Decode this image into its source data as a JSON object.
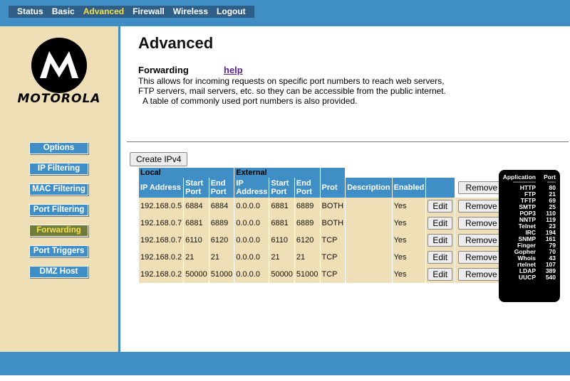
{
  "topnav": {
    "items": [
      "Status",
      "Basic",
      "Advanced",
      "Firewall",
      "Wireless",
      "Logout"
    ],
    "active": "Advanced"
  },
  "brand": {
    "name": "MOTOROLA"
  },
  "sidebar": {
    "items": [
      "Options",
      "IP Filtering",
      "MAC Filtering",
      "Port Filtering",
      "Forwarding",
      "Port Triggers",
      "DMZ Host"
    ],
    "active": "Forwarding"
  },
  "page": {
    "title": "Advanced",
    "section": "Forwarding",
    "help": "help",
    "description_1": "This allows for incoming requests on specific port numbers to reach  web servers,",
    "description_2": "FTP servers, mail servers, etc. so they can be accessible from the public internet.",
    "description_3": "A table of commonly used port numbers is also provided.",
    "create_button": "Create IPv4"
  },
  "table": {
    "group_local": "Local",
    "group_external": "External",
    "headers": [
      "IP Address",
      "Start Port",
      "End Port",
      "IP Address",
      "Start Port",
      "End Port",
      "Prot",
      "Description",
      "Enabled"
    ],
    "remove_all": "Remove All",
    "edit_label": "Edit",
    "remove_label": "Remove",
    "rows": [
      [
        "192.168.0.5",
        "6884",
        "6884",
        "0.0.0.0",
        "6881",
        "6889",
        "BOTH",
        "",
        "Yes"
      ],
      [
        "192.168.0.7",
        "6881",
        "6889",
        "0.0.0.0",
        "6881",
        "6889",
        "BOTH",
        "",
        "Yes"
      ],
      [
        "192.168.0.7",
        "6110",
        "6120",
        "0.0.0.0",
        "6110",
        "6120",
        "TCP",
        "",
        "Yes"
      ],
      [
        "192.168.0.2",
        "21",
        "21",
        "0.0.0.0",
        "21",
        "21",
        "TCP",
        "",
        "Yes"
      ],
      [
        "192.168.0.2",
        "50000",
        "51000",
        "0.0.0.0",
        "50000",
        "51000",
        "TCP",
        "",
        "Yes"
      ]
    ]
  },
  "ports": {
    "header_app": "Application",
    "header_port": "Port",
    "dash_app": "----------------",
    "dash_port": "------",
    "list": [
      [
        "HTTP",
        "80"
      ],
      [
        "FTP",
        "21"
      ],
      [
        "TFTP",
        "69"
      ],
      [
        "SMTP",
        "25"
      ],
      [
        "POP3",
        "110"
      ],
      [
        "NNTP",
        "119"
      ],
      [
        "Telnet",
        "23"
      ],
      [
        "IRC",
        "194"
      ],
      [
        "SNMP",
        "161"
      ],
      [
        "Finger",
        "79"
      ],
      [
        "Gopher",
        "70"
      ],
      [
        "Whois",
        "43"
      ],
      [
        "rtelnet",
        "107"
      ],
      [
        "LDAP",
        "389"
      ],
      [
        "UUCP",
        "540"
      ]
    ]
  },
  "colors": {
    "accent": "#3f8fc6",
    "sidebar": "#efdfb6",
    "active_text": "#f5e04a"
  }
}
